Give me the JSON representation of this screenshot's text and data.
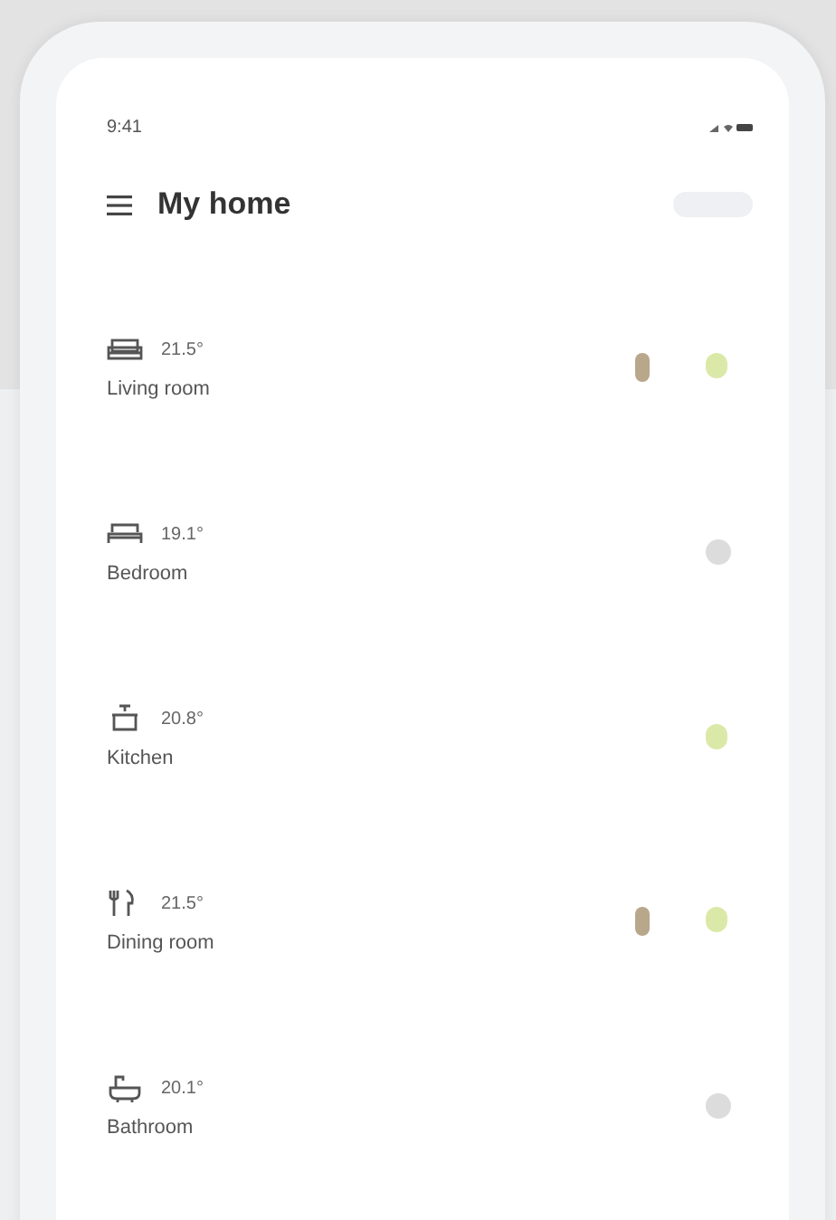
{
  "status_bar": {
    "time": "9:41"
  },
  "header": {
    "title": "My home"
  },
  "rooms": [
    {
      "kind": "sofa",
      "temperature": "21.5°",
      "name": "Living room",
      "indicators": [
        {
          "kind": "lamp",
          "color": "#b9a78c"
        },
        {
          "kind": "leaf",
          "color": "#dbe9a8"
        }
      ]
    },
    {
      "kind": "bed",
      "temperature": "19.1°",
      "name": "Bedroom",
      "indicators": [
        {
          "kind": "disc",
          "color": "#dcdcdc"
        }
      ]
    },
    {
      "kind": "pot",
      "temperature": "20.8°",
      "name": "Kitchen",
      "indicators": [
        {
          "kind": "leaf",
          "color": "#dbe9a8"
        }
      ]
    },
    {
      "kind": "cutlery",
      "temperature": "21.5°",
      "name": "Dining room",
      "indicators": [
        {
          "kind": "lamp",
          "color": "#b9a78c"
        },
        {
          "kind": "leaf",
          "color": "#dbe9a8"
        }
      ]
    },
    {
      "kind": "bath",
      "temperature": "20.1°",
      "name": "Bathroom",
      "indicators": [
        {
          "kind": "disc",
          "color": "#dcdcdc"
        }
      ]
    }
  ]
}
